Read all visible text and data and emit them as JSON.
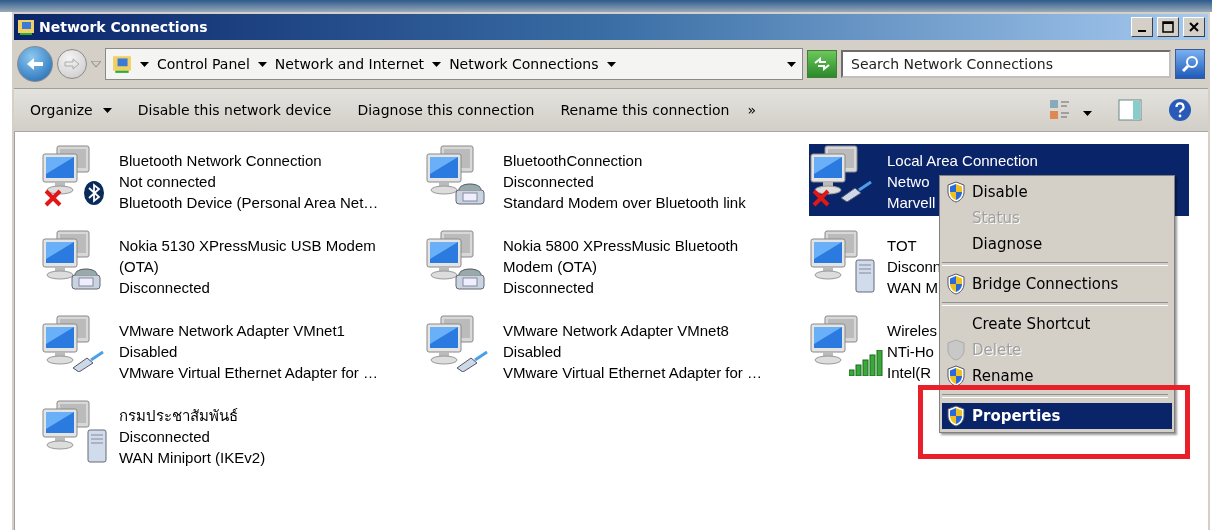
{
  "window": {
    "title": "Network Connections"
  },
  "address_bar": {
    "breadcrumbs": [
      "Control Panel",
      "Network and Internet",
      "Network Connections"
    ]
  },
  "search": {
    "placeholder": "Search Network Connections"
  },
  "command_bar": {
    "items": [
      "Organize",
      "Disable this network device",
      "Diagnose this connection",
      "Rename this connection"
    ],
    "overflow": "»"
  },
  "connections": [
    {
      "name": "Bluetooth Network Connection",
      "status": "Not connected",
      "device": "Bluetooth Device (Personal Area Net…",
      "kind": "bluetooth",
      "error": true,
      "selected": false
    },
    {
      "name": "BluetoothConnection",
      "status": "Disconnected",
      "device": "Standard Modem over Bluetooth link",
      "kind": "modem",
      "error": false,
      "selected": false
    },
    {
      "name": "Local Area Connection",
      "status": "Netwo",
      "device": "Marvell",
      "kind": "cable",
      "error": true,
      "selected": true
    },
    {
      "name": "Nokia 5130 XPressMusic USB Modem (OTA)",
      "status": "Disconnected",
      "kind": "modem",
      "error": false,
      "selected": false
    },
    {
      "name": "Nokia 5800 XPressMusic Bluetooth Modem (OTA)",
      "status": "Disconnected",
      "kind": "modem",
      "error": false,
      "selected": false
    },
    {
      "name": "TOT",
      "status": "Disconn",
      "device": "WAN M",
      "kind": "server",
      "error": false,
      "selected": false
    },
    {
      "name": "VMware Network Adapter VMnet1",
      "status": "Disabled",
      "device": "VMware Virtual Ethernet Adapter for …",
      "kind": "cable",
      "error": false,
      "selected": false
    },
    {
      "name": "VMware Network Adapter VMnet8",
      "status": "Disabled",
      "device": "VMware Virtual Ethernet Adapter for …",
      "kind": "cable",
      "error": false,
      "selected": false
    },
    {
      "name": "Wireles",
      "status": "NTi-Ho",
      "device": "Intel(R",
      "kind": "signal",
      "error": false,
      "selected": false
    },
    {
      "name": "กรมประชาสัมพันธ์",
      "status": "Disconnected",
      "device": "WAN Miniport (IKEv2)",
      "kind": "server",
      "error": false,
      "selected": false
    }
  ],
  "context_menu": [
    {
      "kind": "item",
      "label": "Disable",
      "shield": true,
      "disabled": false,
      "selected": false
    },
    {
      "kind": "item",
      "label": "Status",
      "shield": false,
      "disabled": true,
      "selected": false
    },
    {
      "kind": "item",
      "label": "Diagnose",
      "shield": false,
      "disabled": false,
      "selected": false
    },
    {
      "kind": "separator"
    },
    {
      "kind": "item",
      "label": "Bridge Connections",
      "shield": true,
      "disabled": false,
      "selected": false
    },
    {
      "kind": "separator"
    },
    {
      "kind": "item",
      "label": "Create Shortcut",
      "shield": false,
      "disabled": false,
      "selected": false
    },
    {
      "kind": "item",
      "label": "Delete",
      "shield": true,
      "disabled": true,
      "selected": false
    },
    {
      "kind": "item",
      "label": "Rename",
      "shield": true,
      "disabled": false,
      "selected": false
    },
    {
      "kind": "separator"
    },
    {
      "kind": "item",
      "label": "Properties",
      "shield": true,
      "disabled": false,
      "selected": true
    }
  ],
  "annotation": {
    "kind": "rectangle",
    "color": "#e8202a"
  }
}
